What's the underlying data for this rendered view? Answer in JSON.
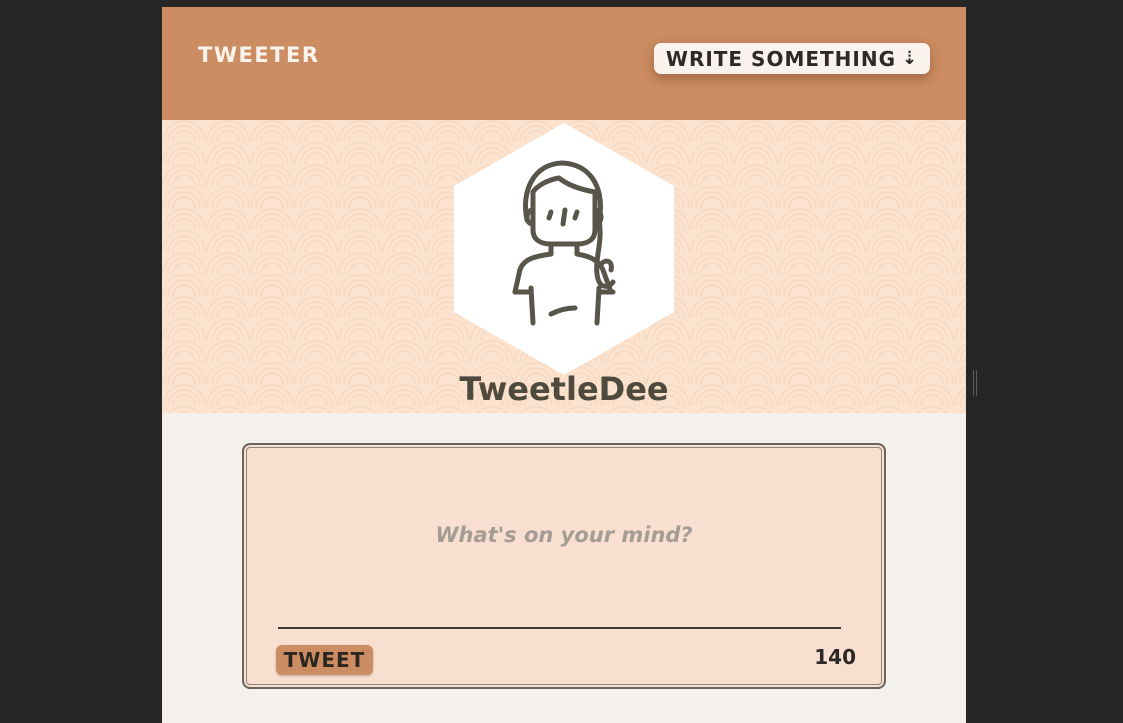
{
  "header": {
    "brand": "TWEETER",
    "write_button_label": "WRITE SOMETHING",
    "write_button_icon": "arrow-down-icon"
  },
  "profile": {
    "username": "TweetleDee",
    "avatar_icon": "woman-avatar-icon"
  },
  "compose": {
    "placeholder": "What's on your mind?",
    "value": "",
    "tweet_button_label": "TWEET",
    "char_counter": "140"
  },
  "colors": {
    "accent": "#cd8d62",
    "banner": "#fbe3cf",
    "card": "#f8dfd0",
    "text_dark": "#2c2a26",
    "page_bg": "#f4f0ec"
  }
}
